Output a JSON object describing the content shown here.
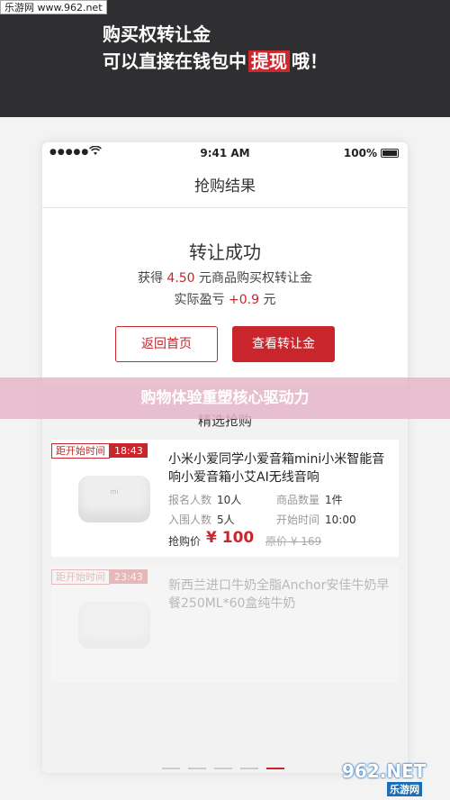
{
  "watermark_top": "乐游网 www.962.net",
  "banner": {
    "line1": "购买权转让金",
    "line2_prefix": "可以直接在钱包中",
    "line2_highlight": "提现",
    "line2_suffix": "哦！"
  },
  "status_bar": {
    "signal": "●●●●●",
    "time": "9:41 AM",
    "battery": "100%"
  },
  "nav_title": "抢购结果",
  "result": {
    "title": "转让成功",
    "gain_prefix": "获得",
    "gain_amount": "4.50",
    "gain_suffix": "元商品购买权转让金",
    "profit_prefix": "实际盈亏",
    "profit_amount": "+0.9",
    "profit_suffix": "元"
  },
  "buttons": {
    "home": "返回首页",
    "view": "查看转让金"
  },
  "section_title": "精选抢购",
  "overlay_caption": "购物体验重塑核心驱动力",
  "products": [
    {
      "badge_label": "距开始时间",
      "badge_time": "18:43",
      "image_logo": "mi",
      "title": "小米小爱同学小爱音箱mini小米智能音响小爱音箱小艾AI无线音响",
      "signup_label": "报名人数",
      "signup_value": "10人",
      "qty_label": "商品数量",
      "qty_value": "1件",
      "enter_label": "入围人数",
      "enter_value": "5人",
      "start_label": "开始时间",
      "start_value": "10:00",
      "price_label": "抢购价",
      "price": "¥ 100",
      "orig_price": "原价 ¥ 169"
    },
    {
      "badge_label": "距开始时间",
      "badge_time": "23:43",
      "title": "新西兰进口牛奶全脂Anchor安佳牛奶早餐250ML*60盒纯牛奶"
    }
  ],
  "watermark_bottom": {
    "main": "962.NET",
    "sub": "乐游网"
  },
  "colors": {
    "accent": "#c8262c",
    "header_bg": "#2f2f31"
  }
}
